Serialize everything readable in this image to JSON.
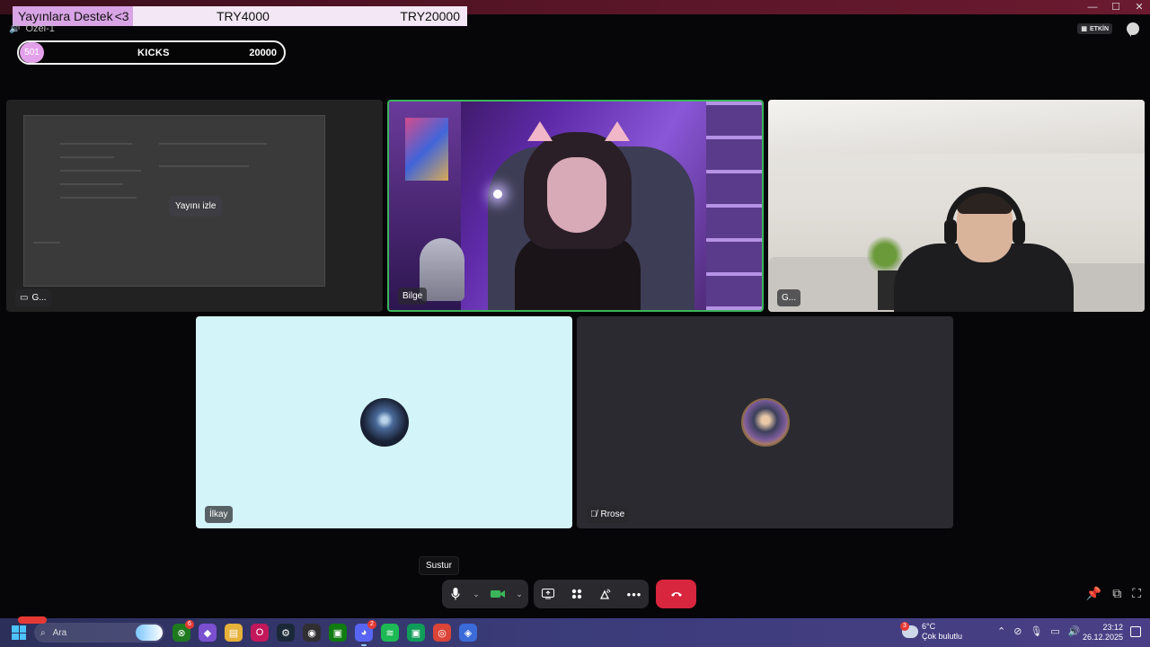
{
  "window": {
    "controls": [
      "—",
      "☐",
      "✕"
    ]
  },
  "donation": {
    "title": "Yayınlara Destek",
    "heart": "<3",
    "current": "TRY4000",
    "goal": "TRY20000"
  },
  "channel": {
    "name": "Özel-1"
  },
  "kicks": {
    "count": "501",
    "label": "KICKS",
    "goal": "20000"
  },
  "header": {
    "activity_label": "ETKİN"
  },
  "tiles": {
    "screen": {
      "label": "G...",
      "watch_button": "Yayını izle"
    },
    "bilge": {
      "label": "Bilge",
      "speaking": true
    },
    "g2": {
      "label": "G..."
    },
    "ilkay": {
      "label": "İlkay"
    },
    "rrose": {
      "label": "Rrose",
      "muted": true
    }
  },
  "controls": {
    "tooltip": "Sustur",
    "icons": [
      "microphone-icon",
      "chevron-down-icon",
      "camera-icon",
      "chevron-down-icon",
      "screen-share-icon",
      "activities-icon",
      "soundboard-icon",
      "more-icon",
      "hang-up-icon"
    ],
    "right_icons": [
      "pin-icon",
      "popout-icon",
      "fullscreen-icon"
    ]
  },
  "taskbar": {
    "search_placeholder": "Ara",
    "apps": [
      {
        "name": "xbox",
        "badge": "6",
        "color": "#1e7a1e"
      },
      {
        "name": "copilot",
        "color": "#7a4fd0"
      },
      {
        "name": "file-explorer",
        "color": "#e6b23a"
      },
      {
        "name": "opera",
        "color": "#c2185b"
      },
      {
        "name": "steam",
        "color": "#1b2838"
      },
      {
        "name": "obs",
        "color": "#302e31"
      },
      {
        "name": "xbox-app",
        "color": "#107c10"
      },
      {
        "name": "discord",
        "badge": "2",
        "color": "#5865f2",
        "active": true
      },
      {
        "name": "spotify",
        "color": "#1db954"
      },
      {
        "name": "game-bar",
        "color": "#0f9d58"
      },
      {
        "name": "chrome",
        "color": "#db4437"
      },
      {
        "name": "app-blue",
        "color": "#3a6bd8"
      }
    ],
    "weather": {
      "temp": "6°C",
      "desc": "Çok bulutlu",
      "badge": "3"
    },
    "clock": {
      "time": "23:12",
      "date": "26.12.2025"
    }
  },
  "colors": {
    "speaking_border": "#3bb55a",
    "hangup": "#d7263d",
    "donation_accent": "#d9a4e5"
  }
}
